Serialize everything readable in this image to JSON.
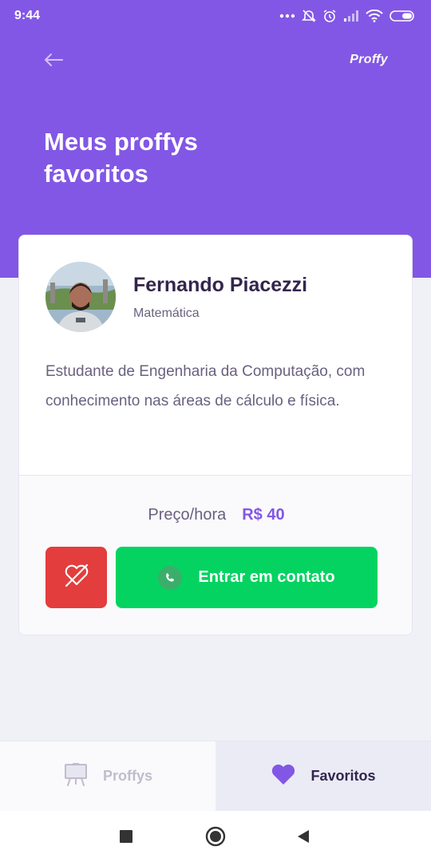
{
  "status_bar": {
    "time": "9:44",
    "icons": [
      "more-dots-icon",
      "alarm-off-icon",
      "alarm-icon",
      "signal-icon",
      "wifi-icon",
      "battery-icon"
    ]
  },
  "header": {
    "back_icon": "arrow-left-icon",
    "logo": "Proffy",
    "title_line1": "Meus proffys",
    "title_line2": "favoritos"
  },
  "teacher_card": {
    "name": "Fernando Piacezzi",
    "subject": "Matemática",
    "bio": "Estudante de Engenharia da Computação, com conhecimento nas áreas de cálculo e física.",
    "price_label": "Preço/hora",
    "price_value": "R$ 40",
    "unfavorite_icon": "heart-off-icon",
    "contact_label": "Entrar em contato",
    "contact_icon": "whatsapp-icon"
  },
  "tabs": [
    {
      "label": "Proffys",
      "icon": "easel-icon",
      "active": false
    },
    {
      "label": "Favoritos",
      "icon": "heart-icon",
      "active": true
    }
  ],
  "system_nav": [
    "recents-square-icon",
    "home-circle-icon",
    "back-triangle-icon"
  ],
  "colors": {
    "primary": "#8257E5",
    "green": "#04D361",
    "red": "#E33D3D",
    "title_dark": "#32264D",
    "text": "#6A6180",
    "background": "#F0F0F7"
  }
}
